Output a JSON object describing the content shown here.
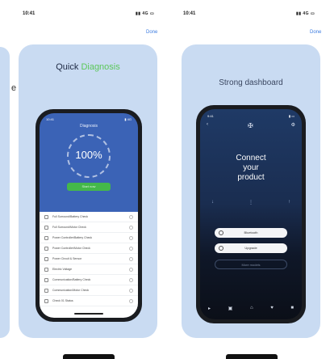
{
  "status_left": {
    "time": "10:41",
    "icons": "▮▮ 4G ▭"
  },
  "status_right": {
    "time": "10:41",
    "icons": "▮▮ 4G ▭"
  },
  "done_left": "Done",
  "done_right": "Done",
  "stray_letter": "e",
  "card1": {
    "title_part1": "Quick ",
    "title_part2": "Diagnosis",
    "accent": "#5cc85a",
    "phone": {
      "status_time": "10:41",
      "status_icons": "▮ 4G",
      "screen_title": "Diagnosis",
      "progress_text": "100%",
      "button_label": "Start now",
      "list": [
        "Full Surround/Battery Check",
        "Full Surround/Motor Check",
        "Power Controller/Battery Check",
        "Power Controller/Motor Check",
        "Power Circuit & Sensor",
        "Electric Voltage",
        "Communication/Battery Check",
        "Communication/Motor Check",
        "Check 01 Status"
      ]
    }
  },
  "card2": {
    "title": "Strong dashboard",
    "phone": {
      "status_time": "9:41",
      "status_icons": "▮ ▭",
      "connect_line1": "Connect",
      "connect_line2": "your",
      "connect_line3": "product",
      "pill1": "Bluetooth",
      "pill2": "Upgrade",
      "pill3": "More models",
      "tab_icons": [
        "▸",
        "▣",
        "⌂",
        "♥",
        "■"
      ]
    }
  }
}
